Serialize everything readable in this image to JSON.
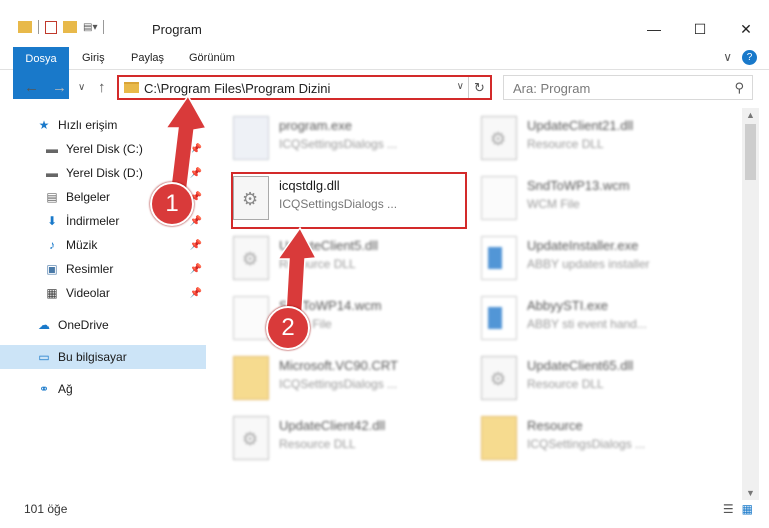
{
  "window": {
    "title": "Program",
    "minimize_glyph": "—",
    "maximize_glyph": "☐",
    "close_glyph": "✕"
  },
  "ribbon": {
    "tabs": [
      "Dosya",
      "Giriş",
      "Paylaş",
      "Görünüm"
    ],
    "expand_glyph": "∨",
    "help_glyph": "?"
  },
  "nav": {
    "back": "←",
    "forward": "→",
    "recent": "∨",
    "up": "↑"
  },
  "address": {
    "path": "C:\\Program Files\\Program Dizini",
    "dropdown_glyph": "∨",
    "refresh_glyph": "↻"
  },
  "search": {
    "placeholder": "Ara: Program",
    "icon_glyph": "⚲"
  },
  "sidebar": {
    "items": [
      {
        "label": "Hızlı erişim",
        "icon": "★",
        "pinned": false
      },
      {
        "label": "Yerel Disk (C:)",
        "icon": "▬",
        "pinned": true
      },
      {
        "label": "Yerel Disk (D:)",
        "icon": "▬",
        "pinned": true
      },
      {
        "label": "Belgeler",
        "icon": "▤",
        "pinned": true
      },
      {
        "label": "İndirmeler",
        "icon": "⬇",
        "pinned": true
      },
      {
        "label": "Müzik",
        "icon": "♪",
        "pinned": true
      },
      {
        "label": "Resimler",
        "icon": "▣",
        "pinned": true
      },
      {
        "label": "Videolar",
        "icon": "▦",
        "pinned": true
      },
      {
        "label": "OneDrive",
        "icon": "☁",
        "pinned": false
      },
      {
        "label": "Bu bilgisayar",
        "icon": "▭",
        "pinned": false
      },
      {
        "label": "Ağ",
        "icon": "⚭",
        "pinned": false
      }
    ],
    "pin_glyph": "📌"
  },
  "files": {
    "left": [
      {
        "name": "program.exe",
        "desc": "ICQSettingsDialogs ...",
        "type": "progexe"
      },
      {
        "name": "icqstdlg.dll",
        "desc": "ICQSettingsDialogs ...",
        "type": "dllicon"
      },
      {
        "name": "UpdateClient5.dll",
        "desc": "Resource DLL",
        "type": "dllicon"
      },
      {
        "name": "SndToWP14.wcm",
        "desc": "WCM File",
        "type": "page"
      },
      {
        "name": "Microsoft.VC90.CRT",
        "desc": "ICQSettingsDialogs ...",
        "type": "folder-ic"
      },
      {
        "name": "UpdateClient42.dll",
        "desc": "Resource DLL",
        "type": "dllicon"
      }
    ],
    "right": [
      {
        "name": "UpdateClient21.dll",
        "desc": "Resource DLL",
        "type": "dllicon"
      },
      {
        "name": "SndToWP13.wcm",
        "desc": "WCM File",
        "type": "page"
      },
      {
        "name": "UpdateInstaller.exe",
        "desc": "ABBY updates installer",
        "type": "exe-inst"
      },
      {
        "name": "AbbyySTI.exe",
        "desc": "ABBY sti event hand...",
        "type": "exe-inst"
      },
      {
        "name": "UpdateClient65.dll",
        "desc": "Resource DLL",
        "type": "dllicon"
      },
      {
        "name": "Resource",
        "desc": "ICQSettingsDialogs ...",
        "type": "folder-ic"
      }
    ]
  },
  "status": {
    "count": "101 öğe",
    "details_view_glyph": "☰",
    "icons_view_glyph": "▦"
  },
  "annotations": {
    "step1": "1",
    "step2": "2",
    "color": "#d93a3a"
  }
}
